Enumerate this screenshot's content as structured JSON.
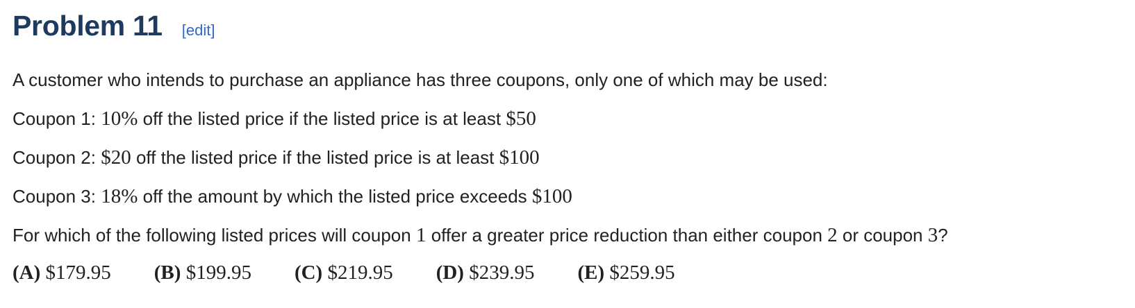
{
  "heading": {
    "title": "Problem 11",
    "edit_open": "[",
    "edit_label": "edit",
    "edit_close": "]"
  },
  "intro": "A customer who intends to purchase an appliance has three coupons, only one of which may be used:",
  "coupons": [
    {
      "label": "Coupon 1:",
      "amount": "10%",
      "text": "off the listed price if the listed price is at least",
      "threshold": "$50"
    },
    {
      "label": "Coupon 2:",
      "amount": "$20",
      "text": "off the listed price if the listed price is at least",
      "threshold": "$100"
    },
    {
      "label": "Coupon 3:",
      "amount": "18%",
      "text": "off the amount by which the listed price exceeds",
      "threshold": "$100"
    }
  ],
  "question": {
    "part1": "For which of the following listed prices will coupon",
    "num1": "1",
    "part2": "offer a greater price reduction than either coupon",
    "num2": "2",
    "part3": "or coupon",
    "num3": "3",
    "part4": "?"
  },
  "choices": [
    {
      "letter": "(A)",
      "value": "$179.95"
    },
    {
      "letter": "(B)",
      "value": "$199.95"
    },
    {
      "letter": "(C)",
      "value": "$219.95"
    },
    {
      "letter": "(D)",
      "value": "$239.95"
    },
    {
      "letter": "(E)",
      "value": "$259.95"
    }
  ],
  "colors": {
    "heading": "#1f3a5f",
    "link": "#3366cc",
    "text": "#202122"
  }
}
